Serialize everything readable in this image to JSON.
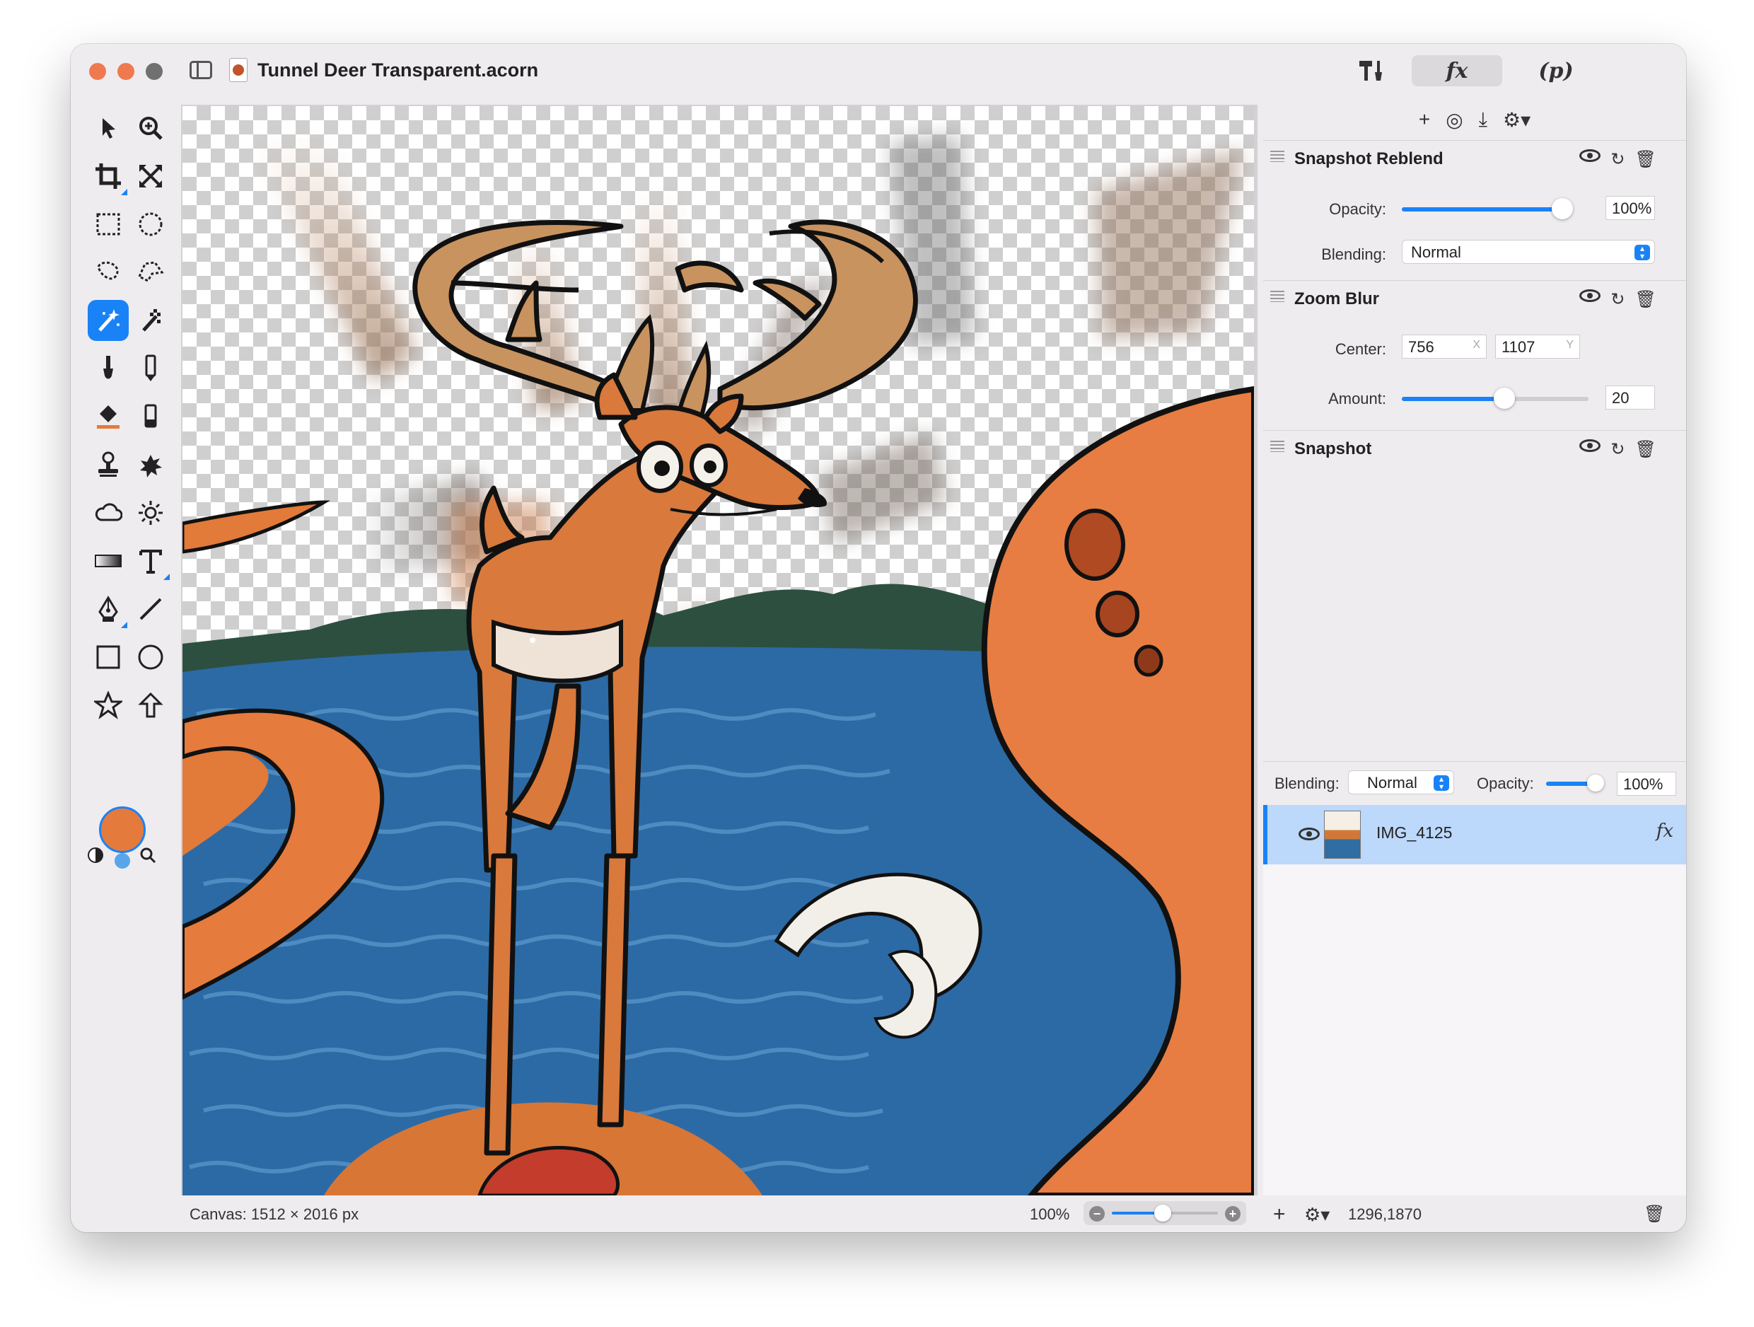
{
  "window": {
    "title": "Tunnel Deer Transparent.acorn"
  },
  "toolbar": {
    "tools_icon": "hammer-brush-icon",
    "fx_label": "fx",
    "p_label": "(p)"
  },
  "tools": [
    {
      "name": "move-tool",
      "icon": "arrow-cursor-icon"
    },
    {
      "name": "zoom-tool",
      "icon": "magnify-plus-icon"
    },
    {
      "name": "crop-tool",
      "icon": "crop-icon"
    },
    {
      "name": "transform-tool",
      "icon": "resize-arrows-icon"
    },
    {
      "name": "rect-select-tool",
      "icon": "dashed-rect-icon"
    },
    {
      "name": "ellipse-select-tool",
      "icon": "dashed-circle-icon"
    },
    {
      "name": "lasso-tool",
      "icon": "lasso-icon"
    },
    {
      "name": "polygon-lasso-tool",
      "icon": "polygon-lasso-icon"
    },
    {
      "name": "magic-wand-tool",
      "icon": "magic-wand-icon"
    },
    {
      "name": "instant-alpha-tool",
      "icon": "wand-checker-icon"
    },
    {
      "name": "brush-tool",
      "icon": "brush-icon"
    },
    {
      "name": "pencil-tool",
      "icon": "pencil-icon"
    },
    {
      "name": "fill-tool",
      "icon": "paint-bucket-icon"
    },
    {
      "name": "eraser-tool",
      "icon": "eraser-icon"
    },
    {
      "name": "clone-tool",
      "icon": "stamp-icon"
    },
    {
      "name": "smudge-tool",
      "icon": "splat-icon"
    },
    {
      "name": "burn-tool",
      "icon": "cloud-icon"
    },
    {
      "name": "dodge-tool",
      "icon": "sun-icon"
    },
    {
      "name": "gradient-tool",
      "icon": "gradient-icon"
    },
    {
      "name": "text-tool",
      "icon": "text-t-icon"
    },
    {
      "name": "pen-tool",
      "icon": "pen-nib-icon"
    },
    {
      "name": "line-tool",
      "icon": "line-icon"
    },
    {
      "name": "rect-shape-tool",
      "icon": "square-icon"
    },
    {
      "name": "oval-shape-tool",
      "icon": "circle-icon"
    },
    {
      "name": "star-tool",
      "icon": "star-icon"
    },
    {
      "name": "arrow-tool",
      "icon": "up-arrow-icon"
    }
  ],
  "colors": {
    "foreground": "#e47a3c",
    "background": "#1a82f7",
    "accent": "#1a82f7",
    "selection": "#bcd8fb"
  },
  "panel": {
    "actions": [
      "plus-icon",
      "filter-add-icon",
      "download-icon",
      "gear-menu-icon"
    ],
    "filters": [
      {
        "name": "Snapshot Reblend",
        "opacity_label": "Opacity:",
        "opacity_value": "100%",
        "opacity_fraction": 1.0,
        "blending_label": "Blending:",
        "blending_value": "Normal"
      },
      {
        "name": "Zoom Blur",
        "center_label": "Center:",
        "center_x": "756",
        "center_x_unit": "X",
        "center_y": "1107",
        "center_y_unit": "Y",
        "amount_label": "Amount:",
        "amount_value": "20",
        "amount_fraction": 0.55
      },
      {
        "name": "Snapshot"
      }
    ],
    "layers_bar": {
      "blending_label": "Blending:",
      "blending_value": "Normal",
      "opacity_label": "Opacity:",
      "opacity_value": "100%",
      "opacity_fraction": 1.0
    },
    "layers": [
      {
        "name": "IMG_4125",
        "fx": "fx",
        "selected": true
      }
    ]
  },
  "status": {
    "canvas_size": "Canvas: 1512 × 2016 px",
    "zoom": "100%",
    "zoom_fraction": 0.48,
    "coords": "1296,1870"
  }
}
